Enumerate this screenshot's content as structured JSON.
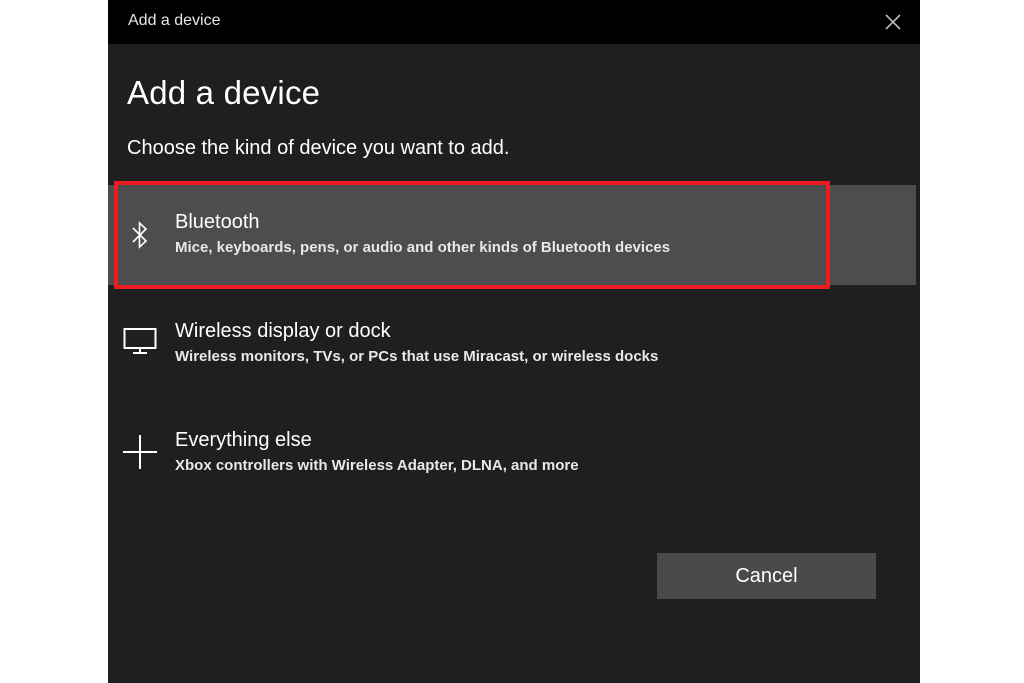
{
  "window": {
    "title": "Add a device",
    "close_icon": "close-icon"
  },
  "page": {
    "heading": "Add a device",
    "subheading": "Choose the kind of device you want to add."
  },
  "options": [
    {
      "icon": "bluetooth-icon",
      "title": "Bluetooth",
      "description": "Mice, keyboards, pens, or audio and other kinds of Bluetooth devices",
      "selected": true
    },
    {
      "icon": "monitor-icon",
      "title": "Wireless display or dock",
      "description": "Wireless monitors, TVs, or PCs that use Miracast, or wireless docks",
      "selected": false
    },
    {
      "icon": "plus-icon",
      "title": "Everything else",
      "description": "Xbox controllers with Wireless Adapter, DLNA, and more",
      "selected": false
    }
  ],
  "footer": {
    "cancel_label": "Cancel"
  },
  "colors": {
    "background": "#1f1f1f",
    "titlebar": "#000000",
    "selected_row": "#4d4d4d",
    "highlight": "#ec1c24",
    "button": "#4a4a4a"
  }
}
